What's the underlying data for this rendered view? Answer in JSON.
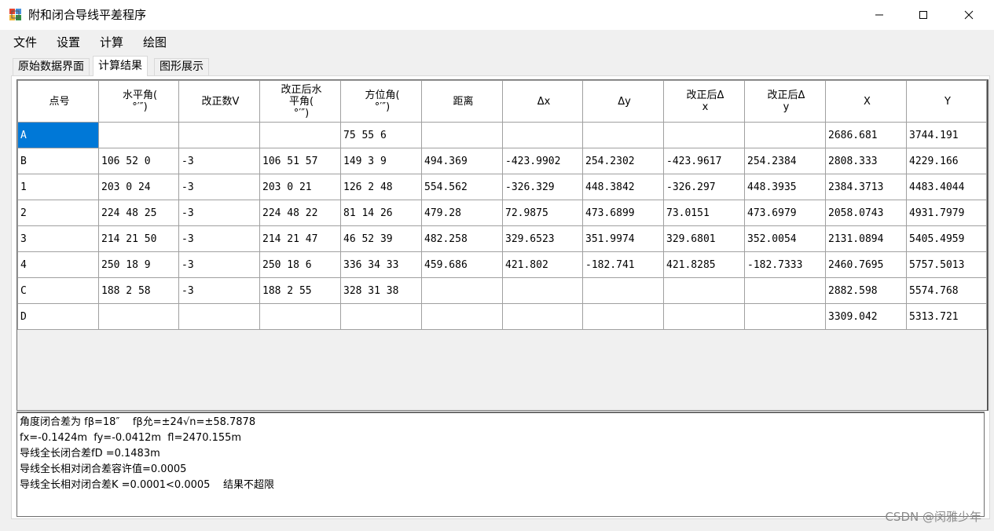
{
  "window": {
    "title": "附和闭合导线平差程序",
    "icon": "app-icon",
    "controls": [
      "minimize-icon",
      "maximize-icon",
      "close-icon"
    ]
  },
  "menu": [
    "文件",
    "设置",
    "计算",
    "绘图"
  ],
  "tabs": [
    {
      "label": "原始数据界面",
      "active": false
    },
    {
      "label": "计算结果",
      "active": true
    },
    {
      "label": "图形展示",
      "active": false
    }
  ],
  "table": {
    "headers": [
      [
        "点号"
      ],
      [
        "水平角(",
        "°′″)"
      ],
      [
        "改正数V"
      ],
      [
        "改正后水",
        "平角(",
        "°′″)"
      ],
      [
        "方位角(",
        "°′″)"
      ],
      [
        "距离"
      ],
      [
        "Δx"
      ],
      [
        "Δy"
      ],
      [
        "改正后Δ",
        "x"
      ],
      [
        "改正后Δ",
        "y"
      ],
      [
        "X"
      ],
      [
        "Y"
      ]
    ],
    "rows": [
      [
        "A",
        "",
        "",
        "",
        "75 55 6",
        "",
        "",
        "",
        "",
        "",
        "2686.681",
        "3744.191"
      ],
      [
        "B",
        "106 52 0",
        "-3",
        "106 51 57",
        "149 3 9",
        "494.369",
        "-423.9902",
        "254.2302",
        "-423.9617",
        "254.2384",
        "2808.333",
        "4229.166"
      ],
      [
        "1",
        "203 0 24",
        "-3",
        "203 0 21",
        "126 2 48",
        "554.562",
        "-326.329",
        "448.3842",
        "-326.297",
        "448.3935",
        "2384.3713",
        "4483.4044"
      ],
      [
        "2",
        "224 48 25",
        "-3",
        "224 48 22",
        "81 14 26",
        "479.28",
        "72.9875",
        "473.6899",
        "73.0151",
        "473.6979",
        "2058.0743",
        "4931.7979"
      ],
      [
        "3",
        "214 21 50",
        "-3",
        "214 21 47",
        "46 52 39",
        "482.258",
        "329.6523",
        "351.9974",
        "329.6801",
        "352.0054",
        "2131.0894",
        "5405.4959"
      ],
      [
        "4",
        "250 18 9",
        "-3",
        "250 18 6",
        "336 34 33",
        "459.686",
        "421.802",
        "-182.741",
        "421.8285",
        "-182.7333",
        "2460.7695",
        "5757.5013"
      ],
      [
        "C",
        "188 2 58",
        "-3",
        "188 2 55",
        "328 31 38",
        "",
        "",
        "",
        "",
        "",
        "2882.598",
        "5574.768"
      ],
      [
        "D",
        "",
        "",
        "",
        "",
        "",
        "",
        "",
        "",
        "",
        "3309.042",
        "5313.721"
      ]
    ],
    "selected_cell": "A"
  },
  "output": {
    "lines": [
      "角度闭合差为 fβ=18″    fβ允=±24√n=±58.7878",
      "fx=-0.1424m  fy=-0.0412m  fl=2470.155m",
      "导线全长闭合差fD =0.1483m",
      "导线全长相对闭合差容许值=0.0005",
      "导线全长相对闭合差K =0.0001<0.0005    结果不超限"
    ]
  },
  "watermark": "CSDN @闵雅少年",
  "colors": {
    "selection": "#0078d7",
    "chrome": "#f0f0f0",
    "grid_line": "#a0a0a0"
  }
}
